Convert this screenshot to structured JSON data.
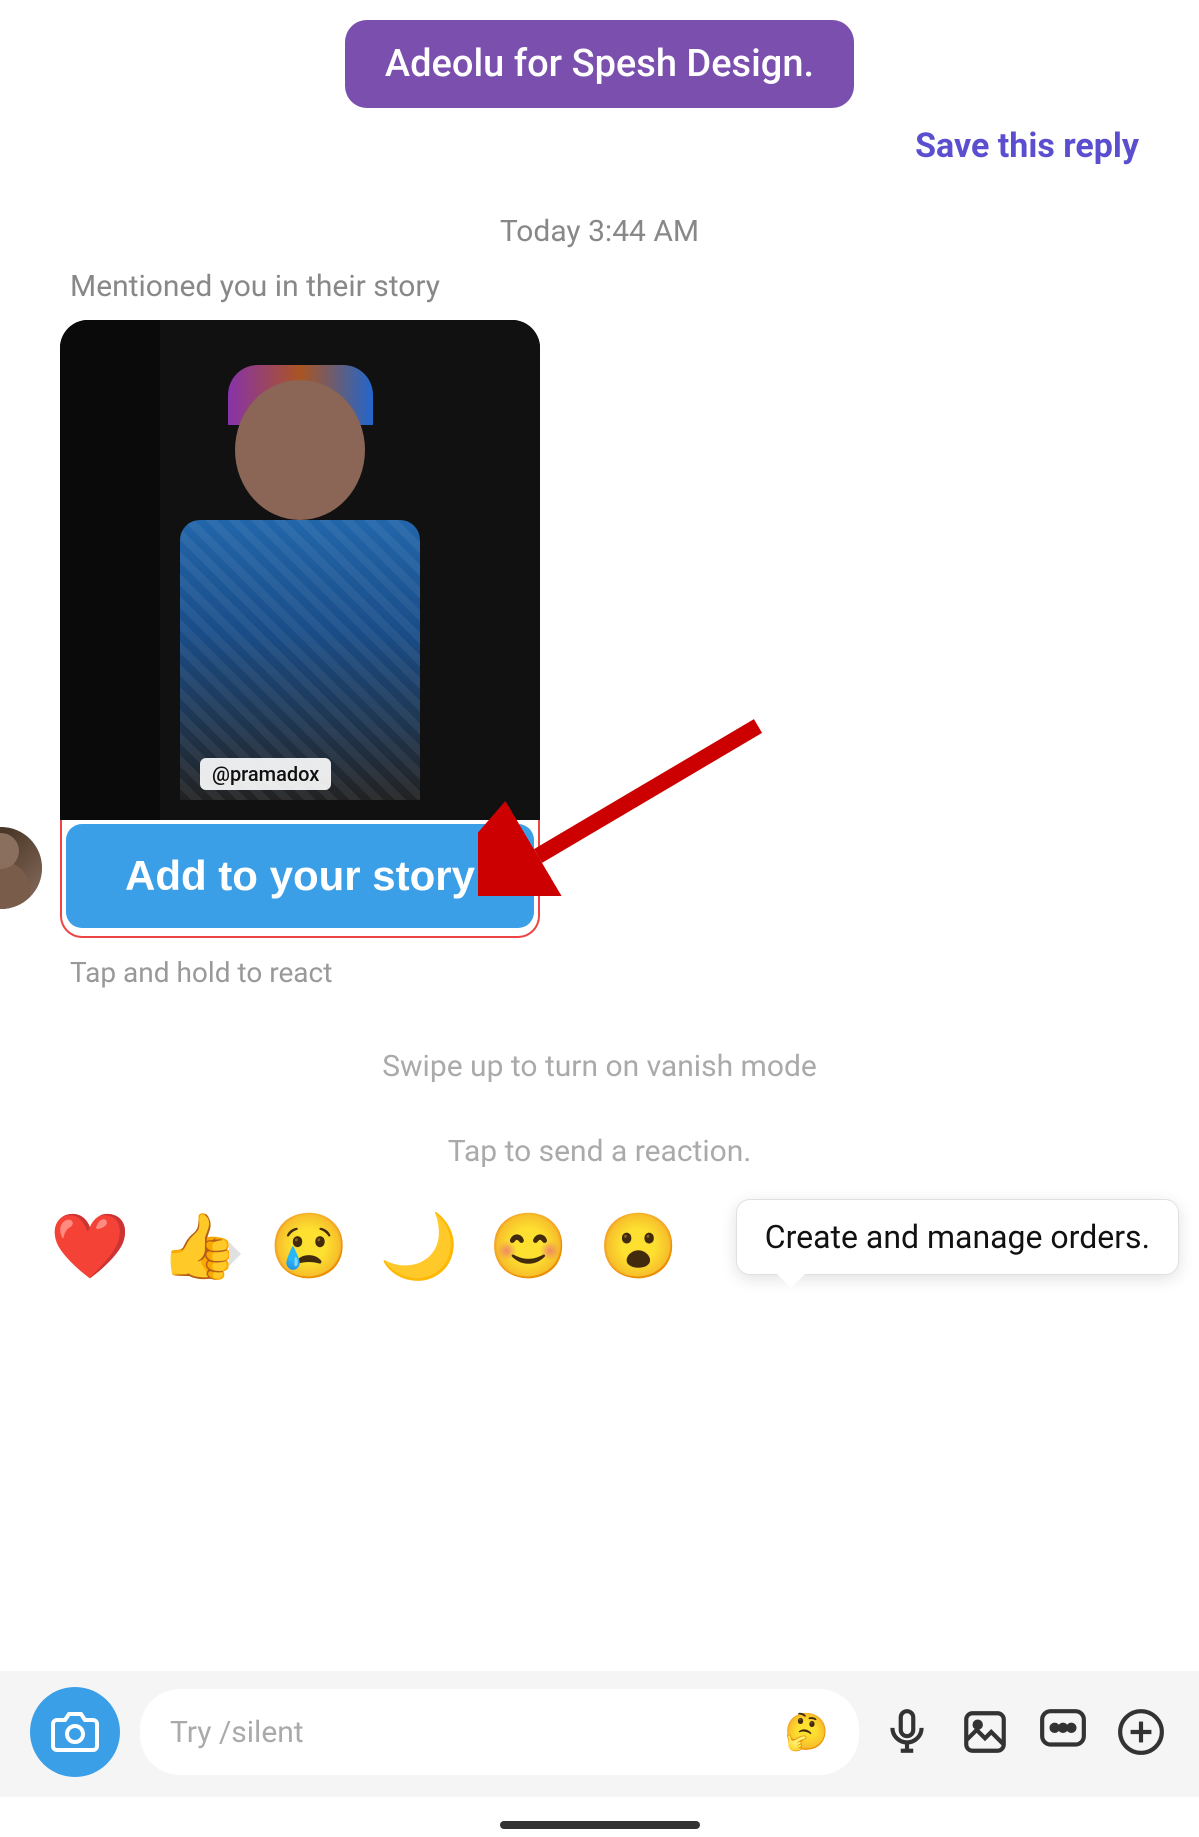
{
  "top": {
    "bubble_text": "Adeolu for Spesh Design.",
    "save_reply": "Save this reply"
  },
  "timestamp": "Today 3:44 AM",
  "message": {
    "mentioned_text": "Mentioned you in their story",
    "mention_tag": "@pramadox",
    "add_story_btn": "Add to your story",
    "tap_hold": "Tap and hold to react"
  },
  "swipe_up": "Swipe up to turn on vanish mode",
  "tap_reaction": "Tap to send a reaction.",
  "tooltip": "Create and manage orders.",
  "input": {
    "placeholder": "Try /silent",
    "emoji": "🤔"
  },
  "emojis": [
    "❤️",
    "👍",
    "😢",
    "🌙",
    "😊",
    "😮"
  ]
}
